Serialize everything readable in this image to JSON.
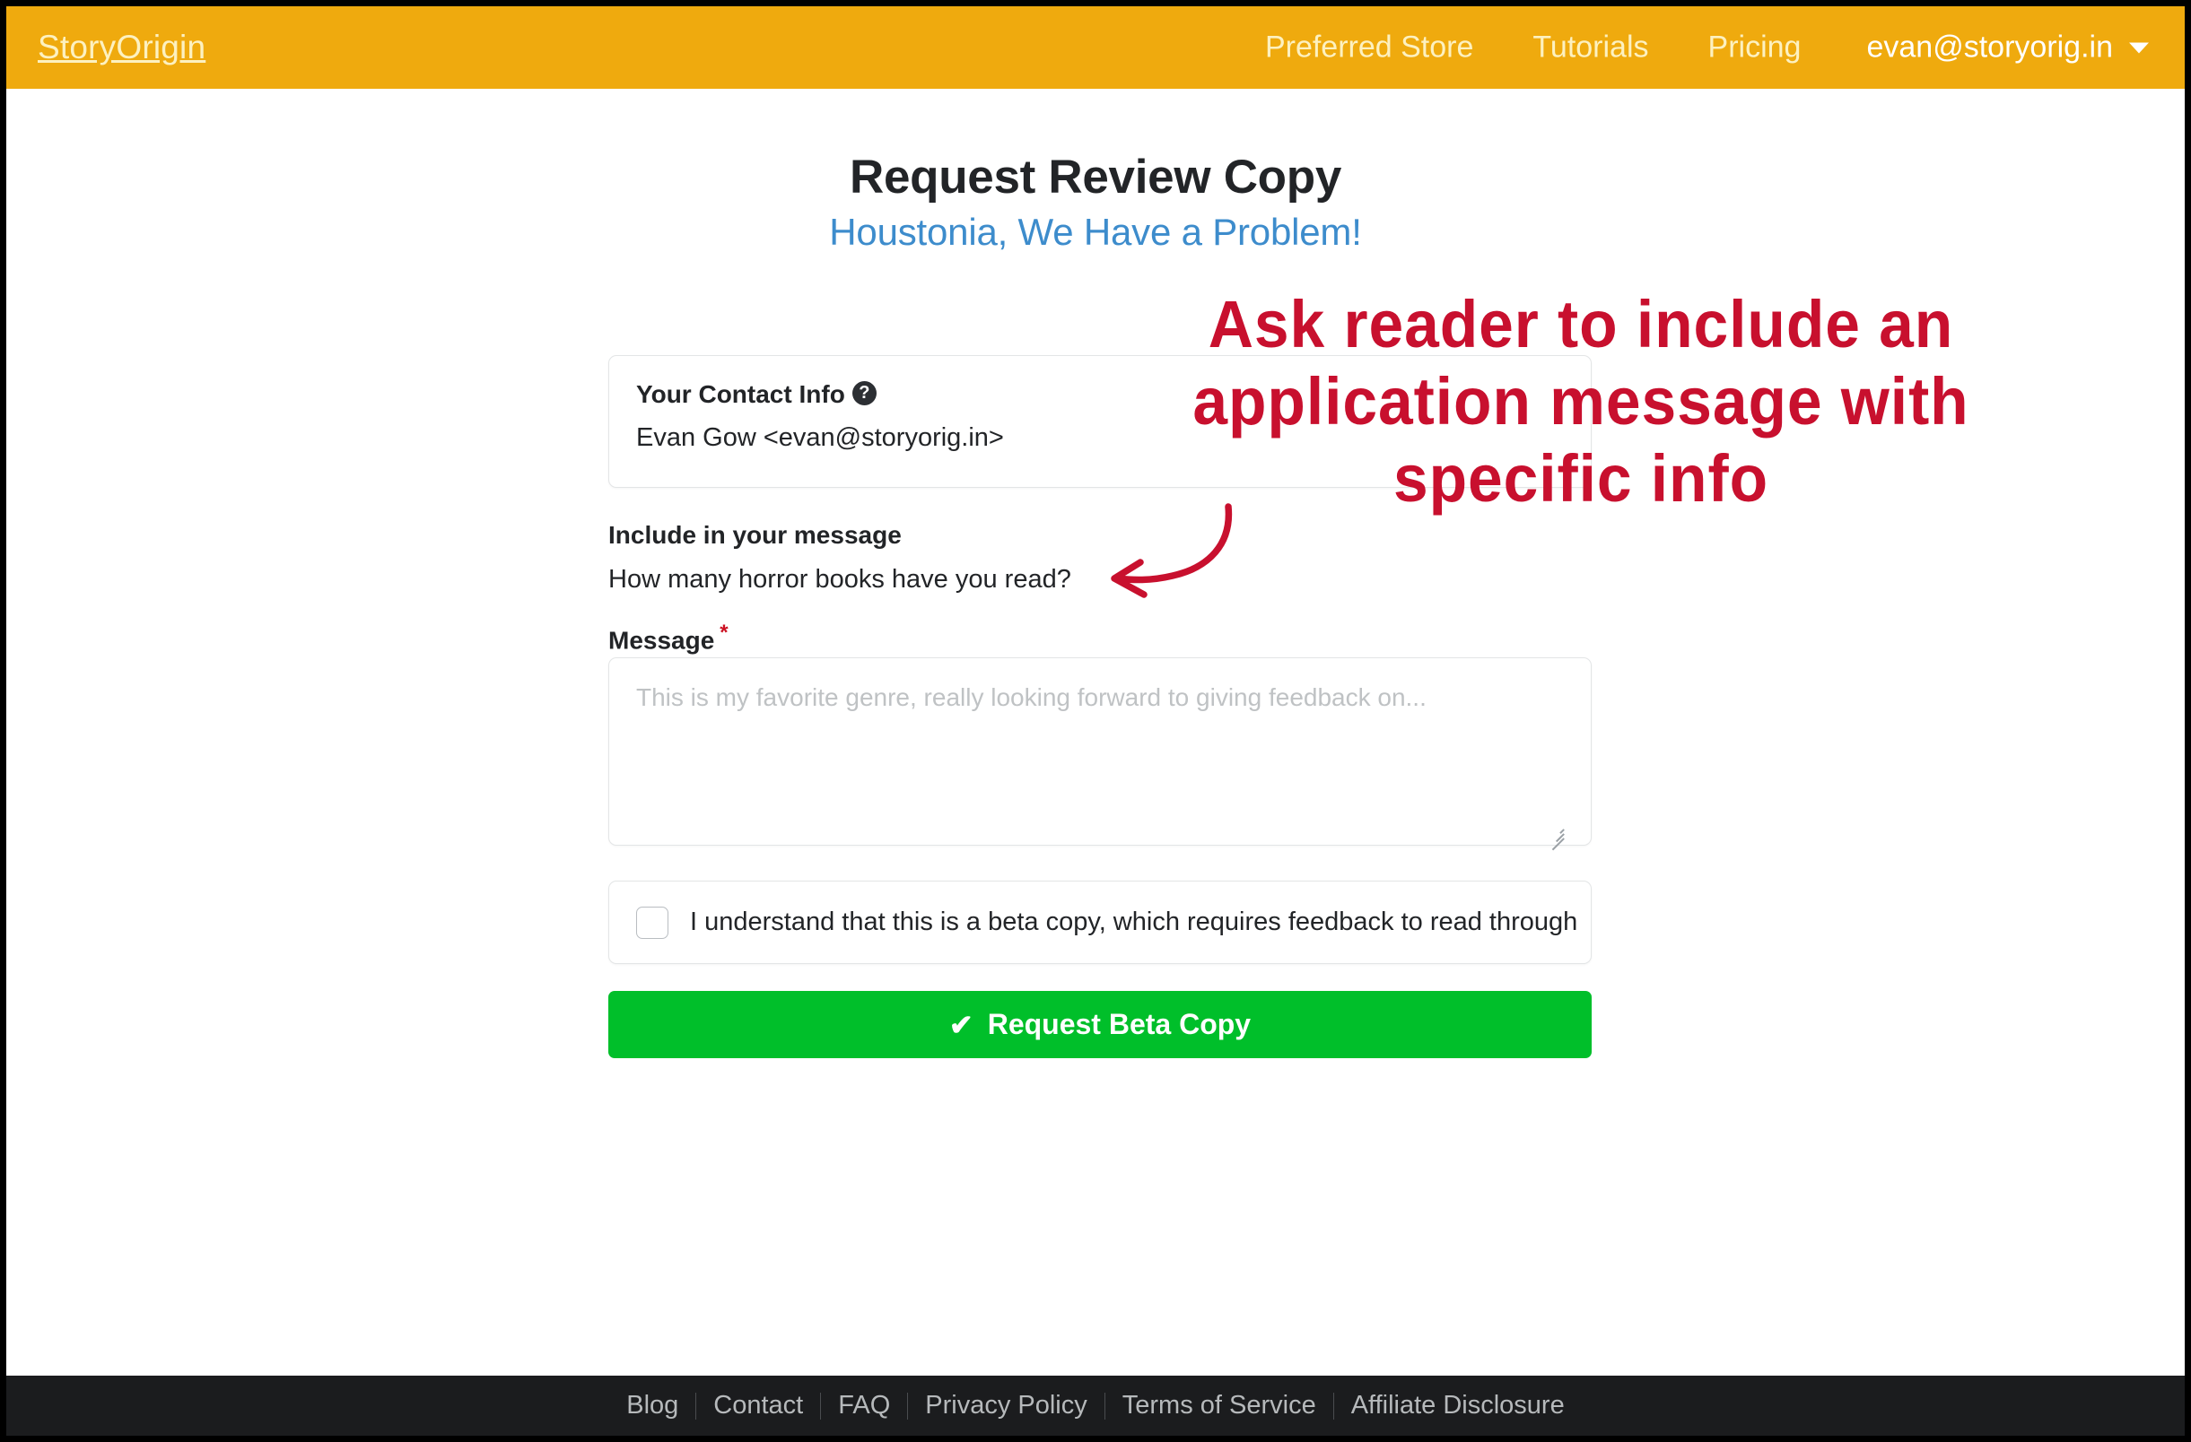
{
  "navbar": {
    "brand": "StoryOrigin",
    "links": [
      {
        "label": "Preferred Store",
        "name": "nav-link-preferred-store"
      },
      {
        "label": "Tutorials",
        "name": "nav-link-tutorials"
      },
      {
        "label": "Pricing",
        "name": "nav-link-pricing"
      }
    ],
    "user_email": "evan@storyorig.in",
    "caret_icon": "chevron-down-icon"
  },
  "header": {
    "title": "Request Review Copy",
    "subtitle": "Houstonia, We Have a Problem!"
  },
  "form": {
    "contact": {
      "label": "Your Contact Info",
      "help_icon": "question-mark-circle-icon",
      "value": "Evan Gow <evan@storyorig.in>"
    },
    "include": {
      "label": "Include in your message",
      "question": "How many horror books have you read?"
    },
    "message": {
      "label": "Message",
      "required_marker": "*",
      "value": "",
      "placeholder": "This is my favorite genre, really looking forward to giving feedback on..."
    },
    "agreement": {
      "checked": false,
      "text": "I understand that this is a beta copy, which requires feedback to read through"
    },
    "submit": {
      "check_icon": "✔",
      "label": "Request Beta Copy"
    }
  },
  "footer": {
    "links": [
      {
        "label": "Blog",
        "name": "footer-link-blog"
      },
      {
        "label": "Contact",
        "name": "footer-link-contact"
      },
      {
        "label": "FAQ",
        "name": "footer-link-faq"
      },
      {
        "label": "Privacy Policy",
        "name": "footer-link-privacy-policy"
      },
      {
        "label": "Terms of Service",
        "name": "footer-link-terms-of-service"
      },
      {
        "label": "Affiliate Disclosure",
        "name": "footer-link-affiliate-disclosure"
      }
    ]
  },
  "annotation": {
    "line1": "Ask reader to include an",
    "line2": "application message with",
    "line3": "specific info",
    "color": "#c8102e",
    "arrow_icon": "curved-arrow-left-icon"
  },
  "colors": {
    "navbar_background": "#efaa0e",
    "navbar_text": "#fdf1c0",
    "subtitle": "#3d8ccc",
    "submit_button": "#00bf2a",
    "footer_background": "#1b1c1e",
    "annotation": "#c8102e"
  }
}
